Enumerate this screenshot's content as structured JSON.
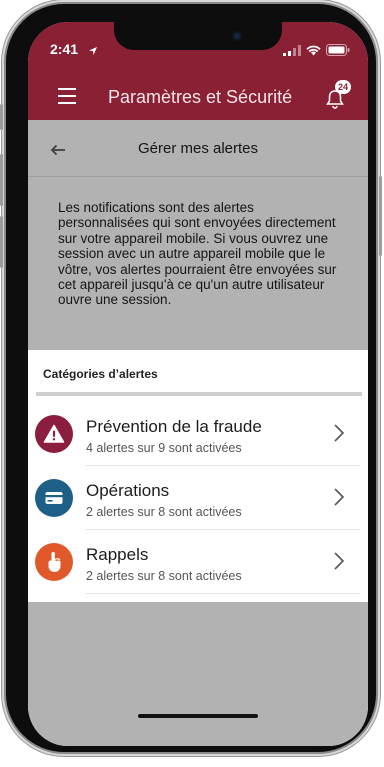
{
  "status": {
    "time": "2:41"
  },
  "header": {
    "title": "Paramètres et Sécurité",
    "notification_count": "24"
  },
  "subheader": {
    "title": "Gérer mes alertes"
  },
  "info": {
    "text": "Les notifications sont des alertes personnalisées qui sont envoyées directement sur votre appareil mobile. Si vous ouvrez une session avec un autre appareil mobile que le vôtre, vos alertes pourraient être envoyées sur cet appareil jusqu'à ce qu'un autre utilisateur ouvre une session."
  },
  "sheet": {
    "title": "Catégories d’alertes",
    "categories": [
      {
        "name": "Prévention de la fraude",
        "desc": "4 alertes sur 9 sont activées",
        "icon": "warning-icon",
        "color": "#8b1e3f"
      },
      {
        "name": "Opérations",
        "desc": "2 alertes sur 8 sont activées",
        "icon": "card-icon",
        "color": "#1e5f87"
      },
      {
        "name": "Rappels",
        "desc": "2 alertes sur 8 sont activées",
        "icon": "reminder-hand-icon",
        "color": "#e1592a"
      }
    ]
  },
  "colors": {
    "brand": "#8a2034",
    "background": "#ffffff"
  }
}
